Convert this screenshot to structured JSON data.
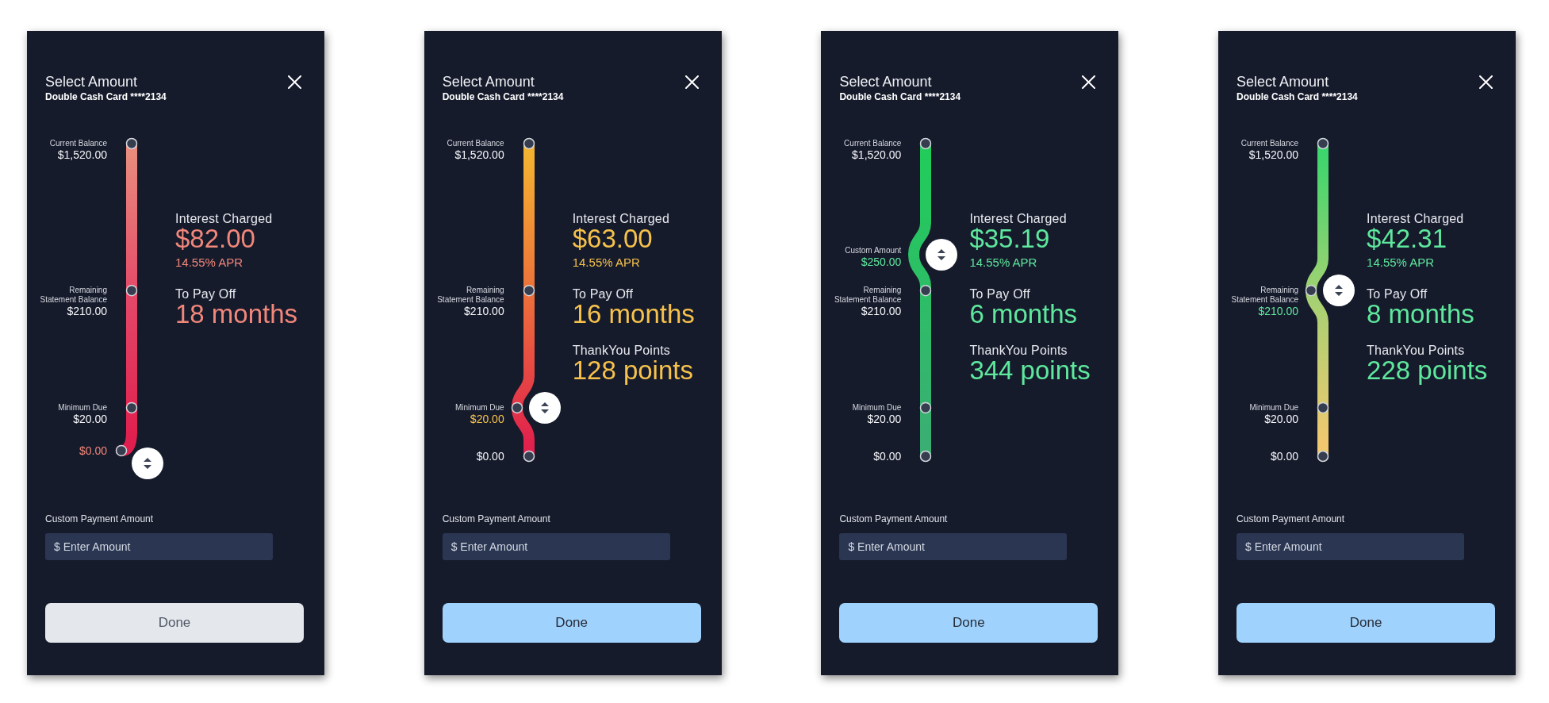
{
  "panels": [
    {
      "title": "Select Amount",
      "subtitle": "Double Cash Card ****2134",
      "color": "#f2877a",
      "track_stops": [
        {
          "color": "#e98b7d"
        },
        {
          "color": "#e34868"
        },
        {
          "color": "#e01f4e"
        }
      ],
      "slider": {
        "markers": [
          {
            "kind": "stop",
            "label": "Current Balance",
            "amount": "$1,520.00",
            "level": 1,
            "selected": false
          },
          {
            "kind": "stop",
            "label": "Remaining Statement Balance",
            "amount": "$210.00",
            "level": 0.53,
            "selected": false
          },
          {
            "kind": "stop",
            "label": "Minimum Due",
            "amount": "$20.00",
            "level": 0.155,
            "selected": false
          },
          {
            "kind": "stop",
            "amount": "$0.00",
            "level": 0.018,
            "selected": true
          }
        ]
      },
      "stats": [
        {
          "label": "Interest Charged",
          "value": "$82.00",
          "note": "14.55% APR"
        },
        {
          "label": "To Pay Off",
          "value": "18 months"
        }
      ],
      "field": {
        "label": "Custom Payment Amount",
        "placeholder": "$ Enter Amount"
      },
      "done": {
        "label": "Done",
        "disabled": true
      }
    },
    {
      "title": "Select Amount",
      "subtitle": "Double Cash Card ****2134",
      "color": "#f6c24b",
      "track_stops": [
        {
          "color": "#f4b231"
        },
        {
          "color": "#ec6d3b"
        },
        {
          "color": "#e1214d"
        }
      ],
      "slider": {
        "markers": [
          {
            "kind": "stop",
            "label": "Current Balance",
            "amount": "$1,520.00",
            "level": 1,
            "selected": false
          },
          {
            "kind": "stop",
            "label": "Remaining Statement Balance",
            "amount": "$210.00",
            "level": 0.53,
            "selected": false
          },
          {
            "kind": "stop",
            "label": "Minimum Due",
            "amount": "$20.00",
            "level": 0.155,
            "selected": true
          },
          {
            "kind": "stop",
            "amount": "$0.00",
            "level": 0,
            "selected": false
          }
        ]
      },
      "stats": [
        {
          "label": "Interest Charged",
          "value": "$63.00",
          "note": "14.55% APR"
        },
        {
          "label": "To Pay Off",
          "value": "16 months"
        },
        {
          "label": "ThankYou Points",
          "value": "128 points"
        }
      ],
      "field": {
        "label": "Custom Payment Amount",
        "placeholder": "$ Enter Amount"
      },
      "done": {
        "label": "Done",
        "disabled": false
      }
    },
    {
      "title": "Select Amount",
      "subtitle": "Double Cash Card ****2134",
      "color": "#5ee89d",
      "track_stops": [
        {
          "color": "#21cc5b"
        },
        {
          "color": "#3aae73"
        }
      ],
      "slider": {
        "markers": [
          {
            "kind": "stop",
            "label": "Current Balance",
            "amount": "$1,520.00",
            "level": 1,
            "selected": false
          },
          {
            "kind": "custom",
            "label": "Custom Amount",
            "amount": "$250.00",
            "level": 0.645,
            "selected": true
          },
          {
            "kind": "stop",
            "label": "Remaining Statement Balance",
            "amount": "$210.00",
            "level": 0.53,
            "selected": false
          },
          {
            "kind": "stop",
            "label": "Minimum Due",
            "amount": "$20.00",
            "level": 0.155,
            "selected": false
          },
          {
            "kind": "stop",
            "amount": "$0.00",
            "level": 0,
            "selected": false
          }
        ]
      },
      "stats": [
        {
          "label": "Interest Charged",
          "value": "$35.19",
          "note": "14.55% APR"
        },
        {
          "label": "To Pay Off",
          "value": "6 months"
        },
        {
          "label": "ThankYou Points",
          "value": "344 points"
        }
      ],
      "field": {
        "label": "Custom Payment Amount",
        "placeholder": "$ Enter Amount"
      },
      "done": {
        "label": "Done",
        "disabled": false
      }
    },
    {
      "title": "Select Amount",
      "subtitle": "Double Cash Card ****2134",
      "color": "#5ee89d",
      "track_stops": [
        {
          "color": "#3dd66c"
        },
        {
          "color": "#a6d173"
        },
        {
          "color": "#f2c86f"
        }
      ],
      "slider": {
        "markers": [
          {
            "kind": "stop",
            "label": "Current Balance",
            "amount": "$1,520.00",
            "level": 1,
            "selected": false
          },
          {
            "kind": "stop",
            "label": "Remaining Statement Balance",
            "amount": "$210.00",
            "level": 0.53,
            "selected": true
          },
          {
            "kind": "stop",
            "label": "Minimum Due",
            "amount": "$20.00",
            "level": 0.155,
            "selected": false
          },
          {
            "kind": "stop",
            "amount": "$0.00",
            "level": 0,
            "selected": false
          }
        ]
      },
      "stats": [
        {
          "label": "Interest Charged",
          "value": "$42.31",
          "note": "14.55% APR"
        },
        {
          "label": "To Pay Off",
          "value": "8 months"
        },
        {
          "label": "ThankYou Points",
          "value": "228 points"
        }
      ],
      "field": {
        "label": "Custom Payment Amount",
        "placeholder": "$ Enter Amount"
      },
      "done": {
        "label": "Done",
        "disabled": false
      }
    }
  ]
}
